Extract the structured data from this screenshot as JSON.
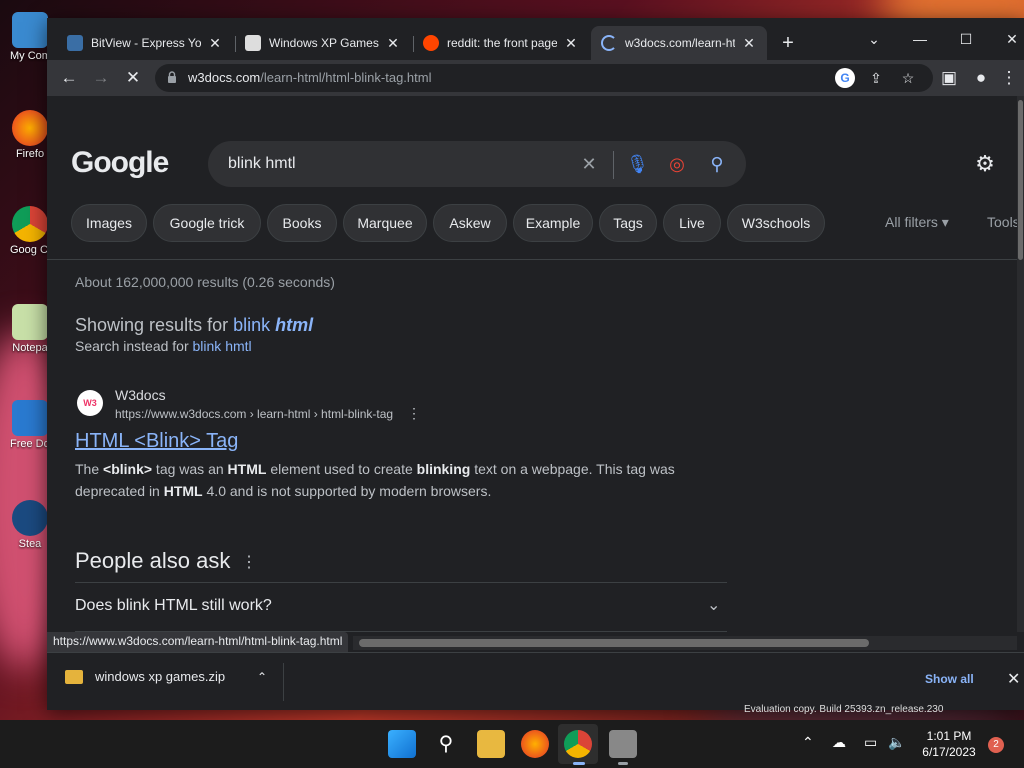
{
  "desktop": {
    "icons": [
      {
        "label": "My Com",
        "icon": "computer-icon"
      },
      {
        "label": "Firefo",
        "icon": "firefox-icon"
      },
      {
        "label": "Goog Chron",
        "icon": "chrome-icon"
      },
      {
        "label": "Notepa",
        "icon": "notepad-icon"
      },
      {
        "label": "Free Down",
        "icon": "download-manager-icon"
      },
      {
        "label": "Stea",
        "icon": "steam-icon"
      }
    ],
    "watermark": "Evaluation copy. Build 25393.zn_release.230"
  },
  "browser": {
    "tabs": [
      {
        "title": "BitView - Express You",
        "icon": "bitview-icon",
        "color": "#3a6ea5"
      },
      {
        "title": "Windows XP Games :",
        "icon": "building-icon",
        "color": "#dddddd"
      },
      {
        "title": "reddit: the front page",
        "icon": "reddit-icon",
        "color": "#ff4500"
      },
      {
        "title": "w3docs.com/learn-ht",
        "icon": "loading-spinner-icon",
        "color": "#8ab4f8"
      }
    ],
    "new_tab": "+",
    "window_controls": {
      "dropdown": "⌄",
      "minimize": "—",
      "maximize": "☐",
      "close": "✕"
    },
    "address": {
      "host": "w3docs.com",
      "path": "/learn-html/html-blink-tag.html"
    },
    "status_url": "https://www.w3docs.com/learn-html/html-blink-tag.html"
  },
  "google": {
    "logo": "Google",
    "query": "blink hmtl",
    "chips": [
      "Images",
      "Google trick",
      "Books",
      "Marquee",
      "Askew",
      "Example",
      "Tags",
      "Live",
      "W3schools"
    ],
    "all_filters": "All filters ▾",
    "tools": "Tools",
    "stats": "About 162,000,000 results (0.26 seconds)",
    "showing_prefix": "Showing results for",
    "showing_word": "blink",
    "showing_bold": "html",
    "instead_prefix": "Search instead for",
    "instead_link": "blink hmtl",
    "result": {
      "favicon_text": "W3",
      "site": "W3docs",
      "url": "https://www.w3docs.com › learn-html › html-blink-tag",
      "title": "HTML <Blink> Tag",
      "snippet_1": "The ",
      "snippet_b1": "<blink>",
      "snippet_2": " tag was an ",
      "snippet_b2": "HTML",
      "snippet_3": " element used to create ",
      "snippet_b3": "blinking",
      "snippet_4": " text on a webpage. This tag was deprecated in ",
      "snippet_b4": "HTML",
      "snippet_5": " 4.0 and is not supported by modern browsers."
    },
    "paa": {
      "title": "People also ask",
      "questions": [
        "Does blink HTML still work?"
      ]
    }
  },
  "downloads": {
    "file": "windows xp games.zip",
    "show_all": "Show all"
  },
  "taskbar": {
    "time": "1:01 PM",
    "date": "6/17/2023",
    "notifications": "2"
  },
  "colors": {
    "link": "#8ab4f8",
    "bg": "#202124",
    "toolbar": "#35363a"
  }
}
